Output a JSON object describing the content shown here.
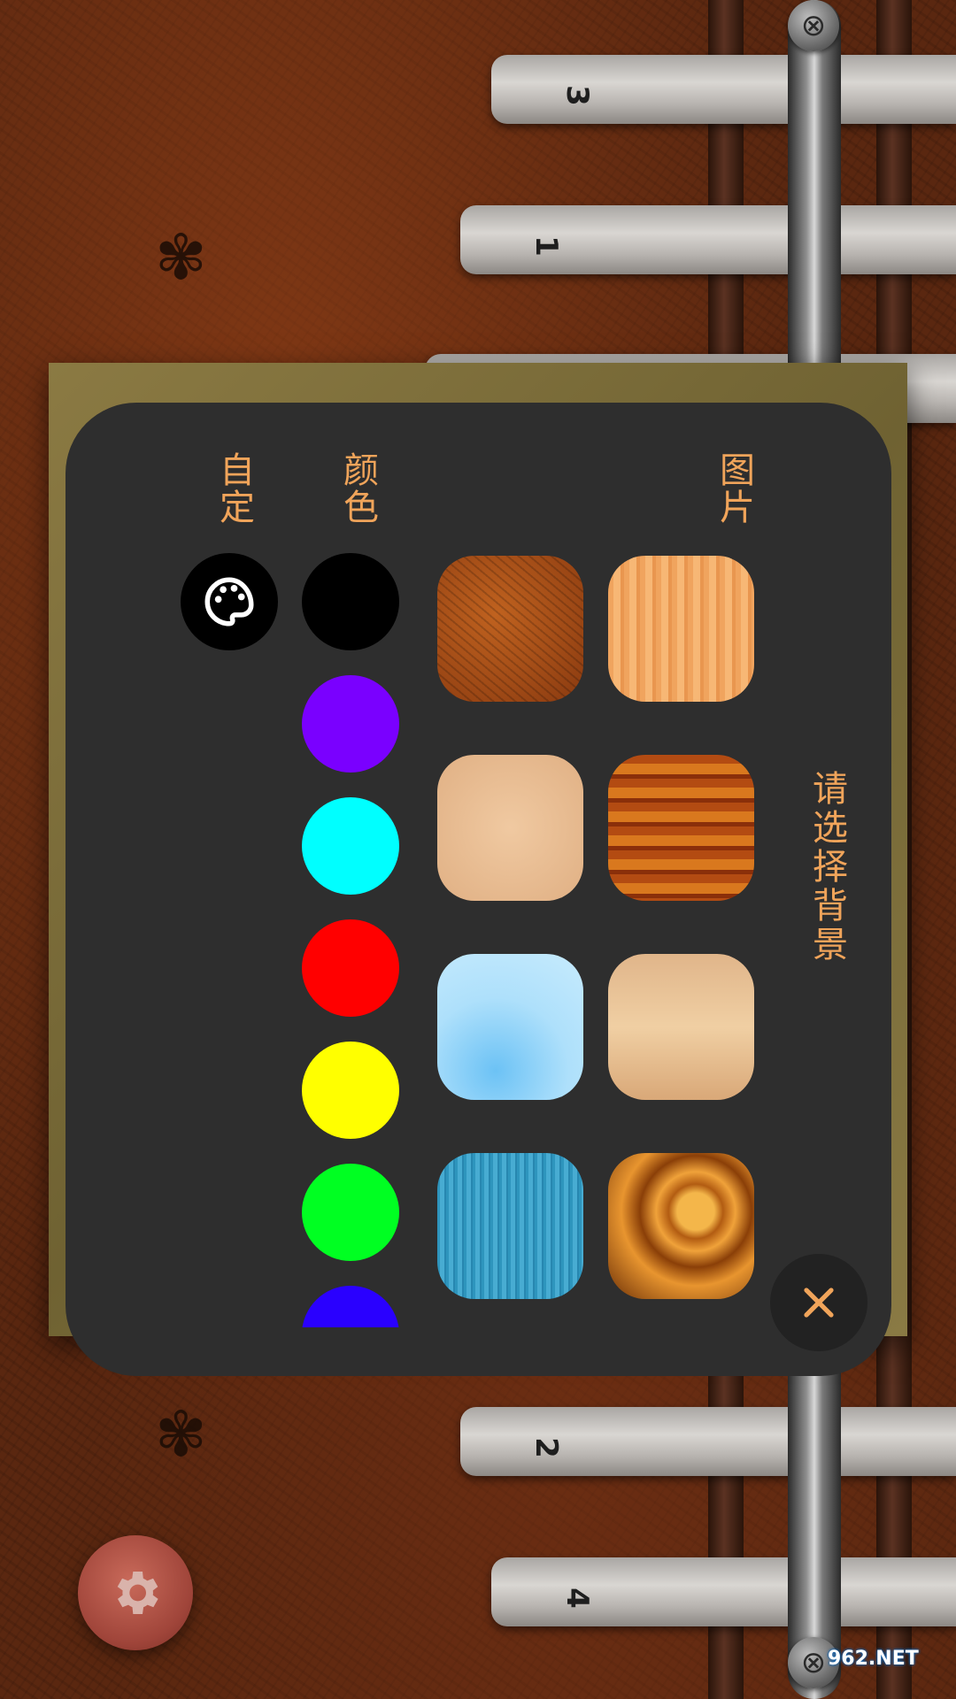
{
  "dialog": {
    "title": "请选择背景",
    "section_images_label": "图片",
    "section_colors_label": "颜色",
    "section_custom_label": "自定",
    "close_icon": "close-icon",
    "palette_icon": "palette-icon"
  },
  "colors": {
    "accent": "#f0a45a",
    "swatches": [
      "#000000",
      "#7a00ff",
      "#00ffff",
      "#ff0000",
      "#ffff00",
      "#00ff22",
      "#2a00ff"
    ]
  },
  "image_tiles": [
    {
      "name": "light-pine-wood"
    },
    {
      "name": "red-brown-wood"
    },
    {
      "name": "pale-maple-wood"
    },
    {
      "name": "golden-burl-wood"
    },
    {
      "name": "brown-leather"
    },
    {
      "name": "beige-cork"
    },
    {
      "name": "light-blue-gradient"
    },
    {
      "name": "blue-fabric"
    }
  ],
  "kalimba": {
    "tine_labels": [
      "3",
      "1",
      "2",
      "4"
    ]
  },
  "settings": {
    "icon": "gear-icon"
  },
  "watermark": {
    "text": "962.NET"
  }
}
